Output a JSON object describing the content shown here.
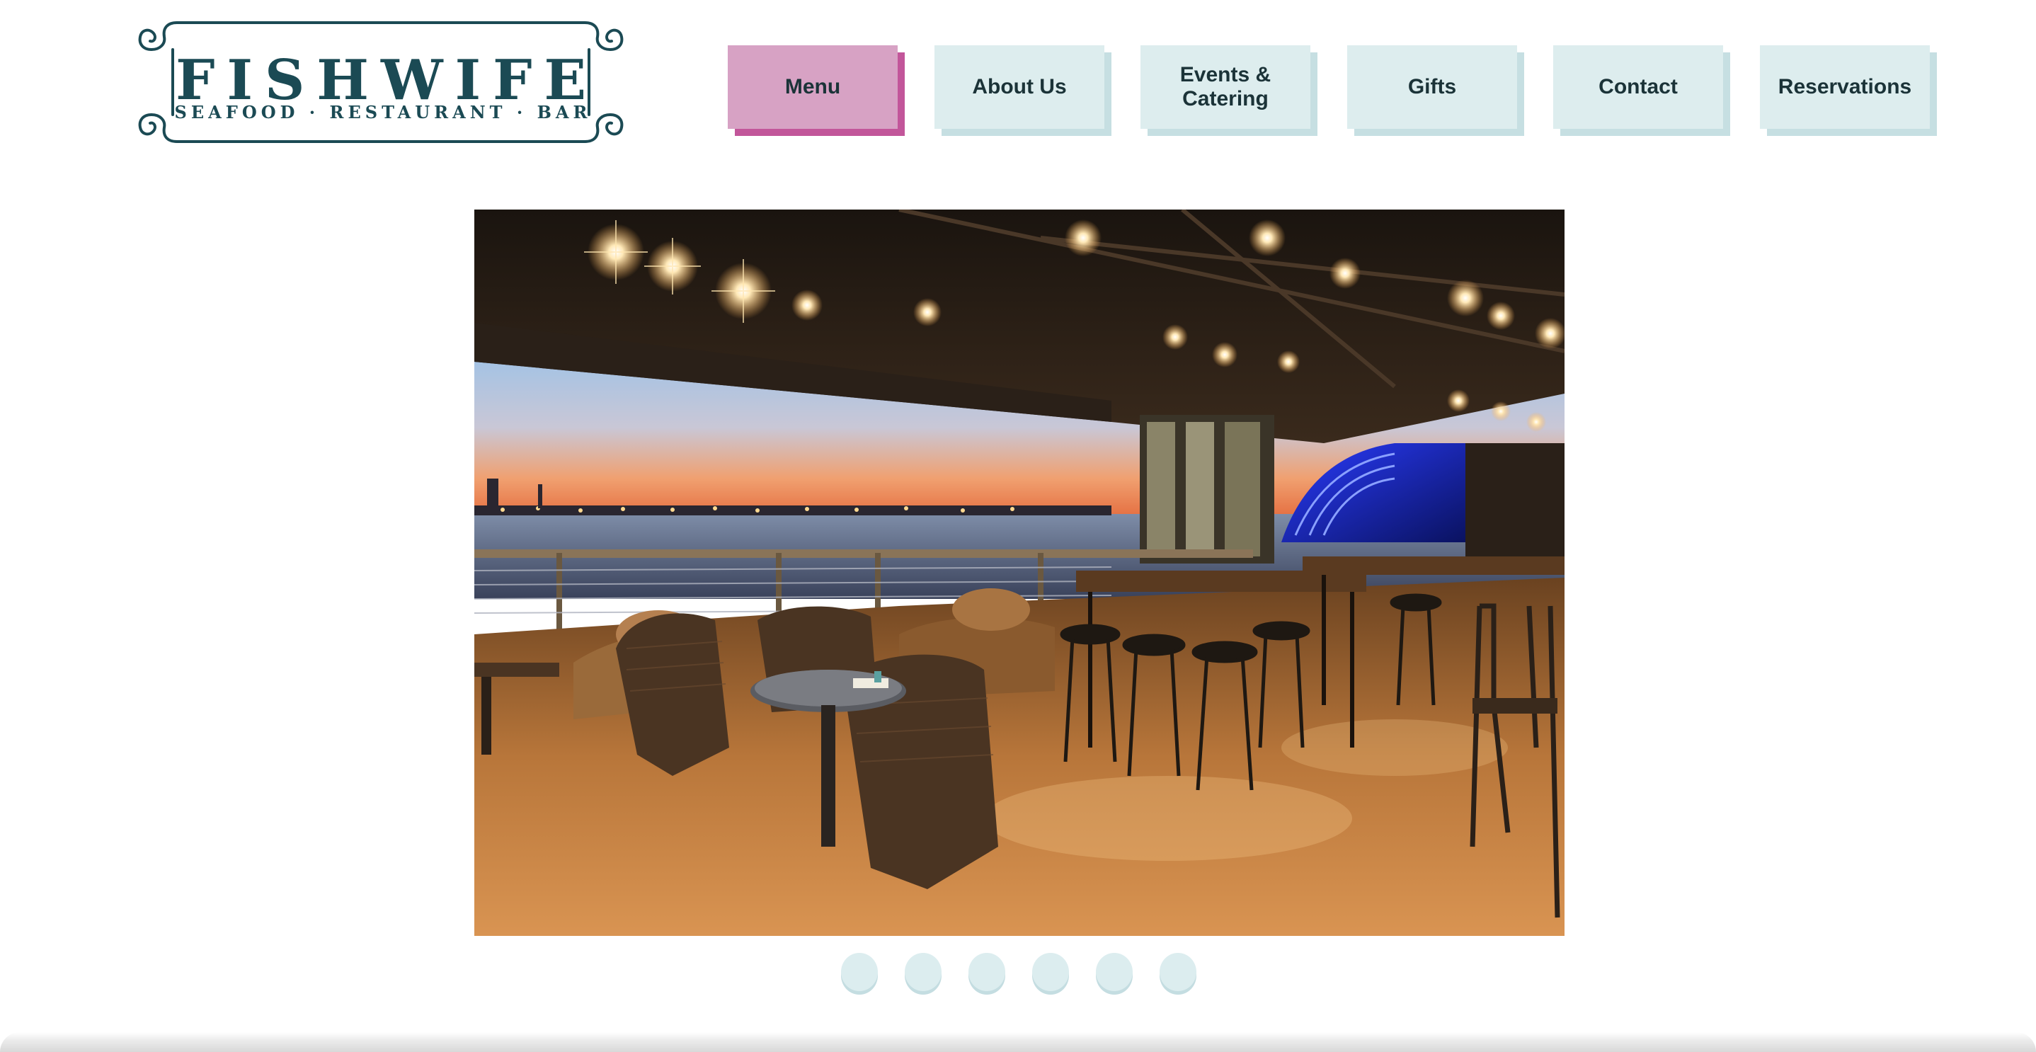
{
  "logo": {
    "title": "FISHWIFE",
    "subtitle": "SEAFOOD · RESTAURANT · BAR",
    "color": "#1b4a54"
  },
  "nav": {
    "active_color": "#d7a2c4",
    "inactive_color": "#ddedee",
    "items": [
      {
        "label": "Menu",
        "active": true
      },
      {
        "label": "About Us",
        "active": false
      },
      {
        "label": "Events &\nCatering",
        "active": false
      },
      {
        "label": "Gifts",
        "active": false
      },
      {
        "label": "Contact",
        "active": false
      },
      {
        "label": "Reservations",
        "active": false
      }
    ]
  },
  "slider": {
    "slide_count": 6,
    "image_subject": "waterfront restaurant patio at dusk"
  }
}
